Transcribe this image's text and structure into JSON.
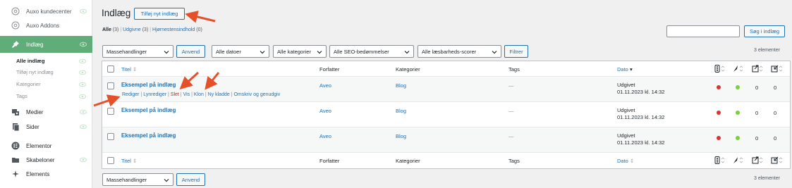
{
  "sidebar": {
    "items": [
      {
        "label": "Auxo kundecenter",
        "icon": "circle-gear-icon"
      },
      {
        "label": "Auxo Addons",
        "icon": "circle-gear-icon"
      },
      {
        "label": "Indlæg",
        "icon": "pin-icon"
      },
      {
        "label": "Medier",
        "icon": "media-icon"
      },
      {
        "label": "Sider",
        "icon": "pages-icon"
      },
      {
        "label": "Elementor",
        "icon": "elementor-icon"
      },
      {
        "label": "Skabeloner",
        "icon": "folder-icon"
      },
      {
        "label": "Elements",
        "icon": "elements-icon"
      }
    ],
    "submenu": [
      {
        "label": "Alle indlæg"
      },
      {
        "label": "Tilføj nyt indlæg"
      },
      {
        "label": "Kategorier"
      },
      {
        "label": "Tags"
      }
    ]
  },
  "header": {
    "title": "Indlæg",
    "add_new_label": "Tilføj nyt indlæg"
  },
  "filters": {
    "all_label": "Alle",
    "all_count": "(3)",
    "published_label": "Udgivne",
    "published_count": "(3)",
    "cornerstone_label": "Hjørnestensindhold",
    "cornerstone_count": "(0)",
    "search_button": "Søg i indlæg"
  },
  "toolbar": {
    "bulk_actions": "Massehandlinger",
    "apply": "Anvend",
    "all_dates": "Alle datoer",
    "all_categories": "Alle kategorier",
    "all_seo": "Alle SEO-bedømmelser",
    "all_readability": "Alle læsbarheds-scorer",
    "filter": "Filtrer",
    "items_count": "3 elementer"
  },
  "table": {
    "columns": {
      "title": "Titel",
      "author": "Forfatter",
      "categories": "Kategorier",
      "tags": "Tags",
      "date": "Dato"
    },
    "rows": [
      {
        "title": "Eksempel på indlæg",
        "author": "Aveo",
        "category": "Blog",
        "tags": "—",
        "status": "Udgivet",
        "date": "01.11.2023 kl. 14:32",
        "seo_color": "#dc3232",
        "read_color": "#7ad03a",
        "links_out": "0",
        "links_in": "0"
      },
      {
        "title": "Eksempel på indlæg",
        "author": "Aveo",
        "category": "Blog",
        "tags": "—",
        "status": "Udgivet",
        "date": "01.11.2023 kl. 14:32",
        "seo_color": "#dc3232",
        "read_color": "#7ad03a",
        "links_out": "0",
        "links_in": "0"
      },
      {
        "title": "Eksempel på indlæg",
        "author": "Aveo",
        "category": "Blog",
        "tags": "—",
        "status": "Udgivet",
        "date": "01.11.2023 kl. 14:32",
        "seo_color": "#dc3232",
        "read_color": "#7ad03a",
        "links_out": "0",
        "links_in": "0"
      }
    ],
    "row_actions": {
      "edit": "Rediger",
      "quick_edit": "Lynrediger",
      "delete": "Slet",
      "view": "Vis",
      "clone": "Klon",
      "new_draft": "Ny kladde",
      "rewrite": "Omskriv og genudgiv"
    }
  },
  "colors": {
    "accent": "#2271b1",
    "active_menu": "#60ad7a",
    "annotation_arrow": "#e5502a"
  }
}
